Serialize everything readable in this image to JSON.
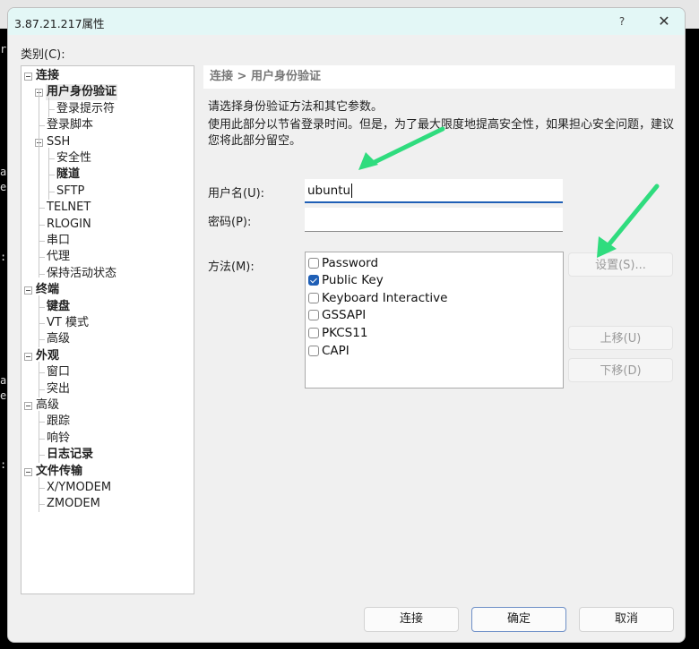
{
  "window": {
    "title": "3.87.21.217属性",
    "help_label": "?",
    "close_label": "✕"
  },
  "background_fragments": [
    "r",
    "a",
    "e",
    ":",
    "a",
    "e",
    ":"
  ],
  "category_label": "类别(C):",
  "tree": [
    {
      "label": "连接",
      "level": 0,
      "bold": true,
      "expanded": true
    },
    {
      "label": "用户身份验证",
      "level": 1,
      "bold": true,
      "expanded": true,
      "selected": true
    },
    {
      "label": "登录提示符",
      "level": 2,
      "bold": false
    },
    {
      "label": "登录脚本",
      "level": 1,
      "bold": false
    },
    {
      "label": "SSH",
      "level": 1,
      "bold": false,
      "expanded": true
    },
    {
      "label": "安全性",
      "level": 2,
      "bold": false
    },
    {
      "label": "隧道",
      "level": 2,
      "bold": true
    },
    {
      "label": "SFTP",
      "level": 2,
      "bold": false
    },
    {
      "label": "TELNET",
      "level": 1,
      "bold": false
    },
    {
      "label": "RLOGIN",
      "level": 1,
      "bold": false
    },
    {
      "label": "串口",
      "level": 1,
      "bold": false
    },
    {
      "label": "代理",
      "level": 1,
      "bold": false
    },
    {
      "label": "保持活动状态",
      "level": 1,
      "bold": false
    },
    {
      "label": "终端",
      "level": 0,
      "bold": true,
      "expanded": true
    },
    {
      "label": "键盘",
      "level": 1,
      "bold": true
    },
    {
      "label": "VT 模式",
      "level": 1,
      "bold": false
    },
    {
      "label": "高级",
      "level": 1,
      "bold": false
    },
    {
      "label": "外观",
      "level": 0,
      "bold": true,
      "expanded": true
    },
    {
      "label": "窗口",
      "level": 1,
      "bold": false
    },
    {
      "label": "突出",
      "level": 1,
      "bold": false
    },
    {
      "label": "高级",
      "level": 0,
      "bold": false,
      "expanded": true
    },
    {
      "label": "跟踪",
      "level": 1,
      "bold": false
    },
    {
      "label": "响铃",
      "level": 1,
      "bold": false
    },
    {
      "label": "日志记录",
      "level": 1,
      "bold": true
    },
    {
      "label": "文件传输",
      "level": 0,
      "bold": true,
      "expanded": true
    },
    {
      "label": "X/YMODEM",
      "level": 1,
      "bold": false
    },
    {
      "label": "ZMODEM",
      "level": 1,
      "bold": false
    }
  ],
  "breadcrumb": "连接 > 用户身份验证",
  "description": {
    "line1": "请选择身份验证方法和其它参数。",
    "line2": "使用此部分以节省登录时间。但是，为了最大限度地提高安全性，如果担心安全问题，建议您将此部分留空。"
  },
  "form": {
    "username_label": "用户名(U):",
    "username_value": "ubuntu",
    "password_label": "密码(P):",
    "password_value": "",
    "method_label": "方法(M):"
  },
  "methods": [
    {
      "label": "Password",
      "checked": false
    },
    {
      "label": "Public Key",
      "checked": true
    },
    {
      "label": "Keyboard Interactive",
      "checked": false
    },
    {
      "label": "GSSAPI",
      "checked": false
    },
    {
      "label": "PKCS11",
      "checked": false
    },
    {
      "label": "CAPI",
      "checked": false
    }
  ],
  "side_buttons": {
    "settings": "设置(S)...",
    "move_up": "上移(U)",
    "move_down": "下移(D)"
  },
  "footer": {
    "connect": "连接",
    "ok": "确定",
    "cancel": "取消"
  },
  "colors": {
    "titlebar": "#e3f7f6",
    "accent": "#1f5fb6",
    "annotation_arrow": "#2fdc7e"
  }
}
